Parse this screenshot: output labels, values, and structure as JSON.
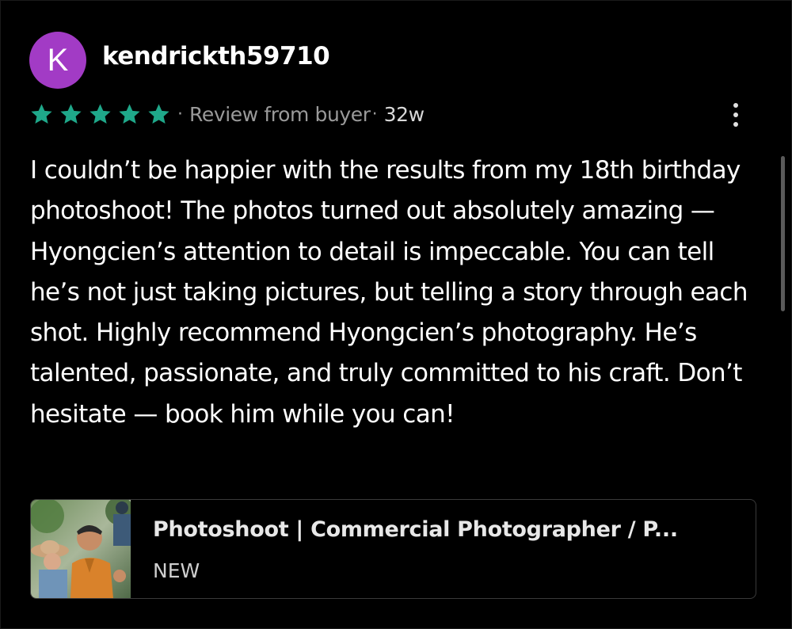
{
  "reviewer": {
    "initial": "K",
    "username": "kendrickth59710",
    "avatar_color": "#a23bc5"
  },
  "rating": {
    "stars": 5,
    "max": 5,
    "color": "#1fa88a"
  },
  "meta": {
    "separator": "·",
    "source": "Review from buyer",
    "age": "32w"
  },
  "review_text": "I couldn’t be happier with the results from my 18th birthday photoshoot! The photos turned out absolutely amazing — Hyongcien’s attention to detail is impeccable. You can tell he’s not just taking pictures, but telling a story through each shot. Highly recommend Hyongcien’s photography. He’s talented, passionate, and truly committed to his craft. Don’t hesitate — book him while you can!",
  "listing": {
    "title": "Photoshoot | Commercial Photographer / P...",
    "badge": "NEW"
  },
  "icons": {
    "more": "more-vertical-icon",
    "star": "star-icon"
  }
}
